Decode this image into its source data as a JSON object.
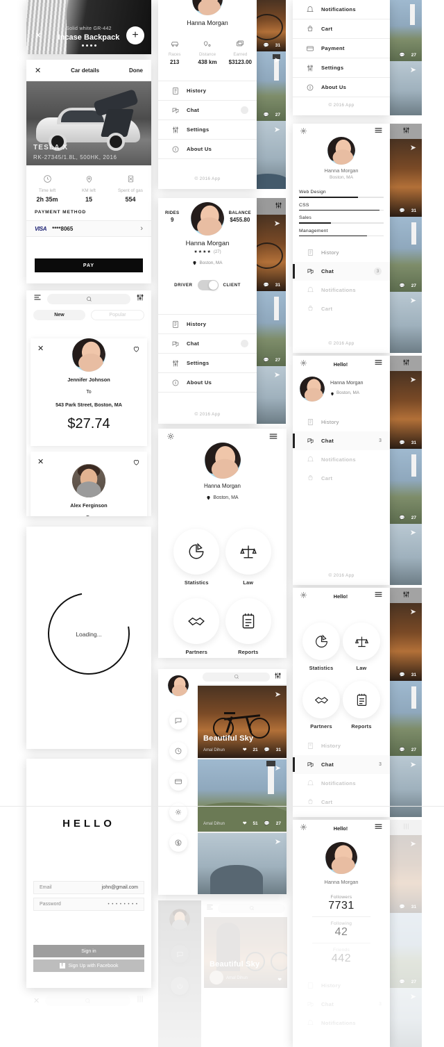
{
  "product_card": {
    "subtitle": "Solid white GR-442",
    "title": "Incase Backpack",
    "close_icon": "close-icon",
    "add_icon": "plus-icon",
    "dots": 4
  },
  "car_details": {
    "nav": {
      "close": "✕",
      "title": "Car details",
      "done": "Done"
    },
    "car_name": "TESLA X",
    "car_spec": "RK-27345/1.8L, 500HK, 2016",
    "stats": [
      {
        "icon": "clock-icon",
        "label": "Time left",
        "value": "2h 35m"
      },
      {
        "icon": "pin-icon",
        "label": "KM left",
        "value": "15"
      },
      {
        "icon": "fuel-icon",
        "label": "Spent of gas",
        "value": "554"
      }
    ],
    "payment_label": "PAYMENT METHOD",
    "card_brand": "VISA",
    "card_number": "****8065",
    "chevron": "›",
    "pay_button": "PAY"
  },
  "ride_list": {
    "menu_icon": "hamburger-icon",
    "search_icon": "search-icon",
    "filter_icon": "filter-icon",
    "tabs": [
      {
        "label": "New",
        "active": true
      },
      {
        "label": "Popular",
        "active": false
      }
    ],
    "cards": [
      {
        "close_icon": "close-icon",
        "like_icon": "heart-icon",
        "name": "Jennifer Johnson",
        "to_label": "To",
        "address": "543 Park Street, Boston, MA",
        "price": "$27.74"
      },
      {
        "close_icon": "close-icon",
        "like_icon": "heart-icon",
        "name": "Alex Ferginson",
        "to_label": "To",
        "address": "",
        "price": ""
      }
    ]
  },
  "loading": {
    "text": "Loading..."
  },
  "login": {
    "title": "HELLO",
    "email_label": "Email",
    "email_value": "john@gmail.com",
    "password_label": "Password",
    "password_value": "• • • • • • • •",
    "signin_button": "Sign in",
    "facebook_button": "Sign Up with Facebook",
    "facebook_icon": "facebook-icon"
  },
  "driver_profile": {
    "name": "Hanna Morgan",
    "stats": [
      {
        "icon": "car-icon",
        "label": "Races",
        "value": "213"
      },
      {
        "icon": "route-icon",
        "label": "Distance",
        "value": "438 km"
      },
      {
        "icon": "money-icon",
        "label": "Earned",
        "value": "$3123.00"
      }
    ],
    "menu": [
      {
        "icon": "history-icon",
        "label": "History",
        "badge": ""
      },
      {
        "icon": "chat-icon",
        "label": "Chat",
        "dot": ""
      },
      {
        "icon": "settings-icon",
        "label": "Settings",
        "badge": ""
      },
      {
        "icon": "about-icon",
        "label": "About Us",
        "badge": ""
      }
    ],
    "copyright": "© 2016 App"
  },
  "balance_profile": {
    "rides_label": "RIDES",
    "rides_value": "9",
    "balance_label": "BALANCE",
    "balance_value": "$455.80",
    "name": "Hanna Morgan",
    "rating_stars": "★★★★",
    "rating_count": "(27)",
    "location_icon": "pin-icon",
    "location": "Boston, MA",
    "toggle_left": "DRIVER",
    "toggle_right": "CLIENT",
    "menu": [
      {
        "icon": "history-icon",
        "label": "History",
        "badge": ""
      },
      {
        "icon": "chat-icon",
        "label": "Chat",
        "dot": ""
      },
      {
        "icon": "settings-icon",
        "label": "Settings",
        "badge": ""
      },
      {
        "icon": "about-icon",
        "label": "About Us",
        "badge": ""
      }
    ],
    "copyright": "© 2016 App"
  },
  "dashboard": {
    "gear_icon": "gear-icon",
    "menu_icon": "hamburger-icon",
    "name": "Hanna Morgan",
    "location_icon": "pin-icon",
    "location": "Boston, MA",
    "tiles": [
      {
        "icon": "pie-chart-icon",
        "label": "Statistics"
      },
      {
        "icon": "scales-icon",
        "label": "Law"
      },
      {
        "icon": "handshake-icon",
        "label": "Partners"
      },
      {
        "icon": "notepad-icon",
        "label": "Reports"
      }
    ]
  },
  "feed_drawer": {
    "avatar": "avatar",
    "side_icons": [
      "chat-icon",
      "clock-icon",
      "card-icon",
      "gear-icon",
      "dollar-icon"
    ],
    "search_icon": "search-icon",
    "filter_icon": "filter-icon",
    "posts": [
      {
        "title": "Beautiful Sky",
        "author": "Amal Dihun",
        "likes": "21",
        "comments": "31",
        "image": "bicycle-sunset"
      },
      {
        "title": "",
        "author": "Amal Dihun",
        "likes": "51",
        "comments": "27",
        "image": "lighthouse-coast"
      },
      {
        "title": "",
        "author": "",
        "likes": "",
        "comments": "",
        "image": "rock-sea"
      }
    ]
  },
  "feed_drawer_faded": {
    "menu_icon": "hamburger-icon",
    "search_icon": "search-icon",
    "post_title": "Beautiful Sky",
    "post_author": "Amal Dihun",
    "like_icon": "heart-icon",
    "side_icons": [
      "chat-icon",
      "power-icon"
    ]
  },
  "shop_menu": {
    "items": [
      {
        "icon": "notifications-icon",
        "label": "Notifications"
      },
      {
        "icon": "cart-icon",
        "label": "Cart"
      },
      {
        "icon": "card-icon",
        "label": "Payment"
      },
      {
        "icon": "settings-icon",
        "label": "Settings"
      },
      {
        "icon": "about-icon",
        "label": "About Us"
      }
    ],
    "copyright": "© 2016 App"
  },
  "skills_menu": {
    "gear_icon": "gear-icon",
    "menu_icon": "hamburger-icon",
    "name": "Hanna Morgan",
    "location": "Boston, MA",
    "skills": [
      {
        "label": "Web Design",
        "value": 70
      },
      {
        "label": "CSS",
        "value": 95
      },
      {
        "label": "Sales",
        "value": 38
      },
      {
        "label": "Management",
        "value": 80
      }
    ],
    "menu": [
      {
        "icon": "history-icon",
        "label": "History",
        "badge": "",
        "active": false
      },
      {
        "icon": "chat-icon",
        "label": "Chat",
        "badge": "3",
        "active": true
      },
      {
        "icon": "notifications-icon",
        "label": "Notifications",
        "badge": "",
        "active": false
      },
      {
        "icon": "cart-icon",
        "label": "Cart",
        "badge": "",
        "active": false
      }
    ],
    "copyright": "© 2016 App"
  },
  "hello_menu": {
    "gear_icon": "gear-icon",
    "title": "Hello!",
    "menu_icon": "hamburger-icon",
    "name": "Hanna Morgan",
    "location_icon": "pin-icon",
    "location": "Boston, MA",
    "menu": [
      {
        "icon": "history-icon",
        "label": "History",
        "badge": "",
        "active": false
      },
      {
        "icon": "chat-icon",
        "label": "Chat",
        "badge": "3",
        "active": true
      },
      {
        "icon": "notifications-icon",
        "label": "Notifications",
        "badge": "",
        "active": false
      },
      {
        "icon": "cart-icon",
        "label": "Cart",
        "badge": "",
        "active": false
      }
    ],
    "copyright": "© 2016 App"
  },
  "hello_grid": {
    "gear_icon": "gear-icon",
    "title": "Hello!",
    "menu_icon": "hamburger-icon",
    "tiles": [
      {
        "icon": "pie-chart-icon",
        "label": "Statistics"
      },
      {
        "icon": "scales-icon",
        "label": "Law"
      },
      {
        "icon": "handshake-icon",
        "label": "Partners"
      },
      {
        "icon": "notepad-icon",
        "label": "Reports"
      }
    ],
    "menu": [
      {
        "icon": "history-icon",
        "label": "History",
        "badge": "",
        "active": false
      },
      {
        "icon": "chat-icon",
        "label": "Chat",
        "badge": "3",
        "active": true
      },
      {
        "icon": "notifications-icon",
        "label": "Notifications",
        "badge": "",
        "active": false
      },
      {
        "icon": "cart-icon",
        "label": "Cart",
        "badge": "",
        "active": false
      }
    ]
  },
  "followers_menu": {
    "gear_icon": "gear-icon",
    "title": "Hello!",
    "menu_icon": "hamburger-icon",
    "name": "Hanna Morgan",
    "stats": [
      {
        "label": "Followers",
        "value": "7731"
      },
      {
        "label": "Following",
        "value": "42"
      },
      {
        "label": "Friends",
        "value": "442"
      }
    ],
    "menu": [
      {
        "icon": "history-icon",
        "label": "History",
        "badge": ""
      },
      {
        "icon": "chat-icon",
        "label": "Chat",
        "badge": "3"
      },
      {
        "icon": "notifications-icon",
        "label": "Notifications",
        "badge": ""
      }
    ]
  },
  "colors": {
    "accent_blue": "#a9dcf0",
    "ink": "#1d1d1d",
    "muted": "#b4b4b4",
    "panel_bg": "#ffffff",
    "page_bg": "#ffffff",
    "visa_blue": "#1a1f71"
  }
}
